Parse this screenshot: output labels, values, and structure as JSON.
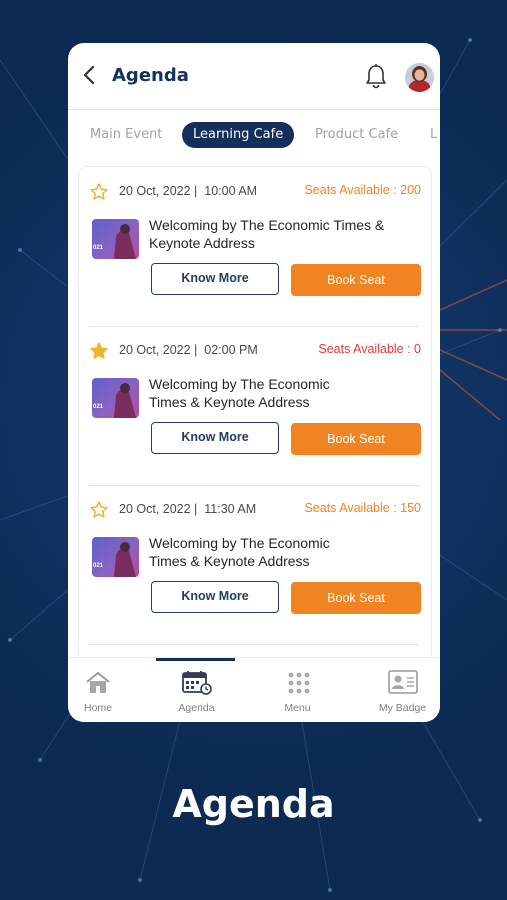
{
  "header": {
    "title": "Agenda",
    "back_icon": "chevron-left-icon",
    "bell_icon": "bell-icon",
    "avatar": "user-avatar"
  },
  "tabs": [
    {
      "label": "Main Event",
      "active": false
    },
    {
      "label": "Learning Cafe",
      "active": true
    },
    {
      "label": "Product Cafe",
      "active": false
    },
    {
      "label": "L",
      "active": false
    }
  ],
  "events": [
    {
      "starred": false,
      "date": "20 Oct, 2022",
      "time": "10:00 AM",
      "seats_text": "Seats Available : 200",
      "seats_color": "#f08423",
      "title": "Welcoming by The Economic Times & Keynote Address",
      "thumb_tag": "021",
      "know_more": "Know More",
      "book_seat": "Book Seat"
    },
    {
      "starred": true,
      "date": "20 Oct, 2022",
      "time": "02:00 PM",
      "seats_text": "Seats Available : 0",
      "seats_color": "#e53935",
      "title": "Welcoming by The Economic Times & Keynote Address",
      "thumb_tag": "021",
      "know_more": "Know More",
      "book_seat": "Book Seat"
    },
    {
      "starred": false,
      "date": "20 Oct, 2022",
      "time": "11:30 AM",
      "seats_text": "Seats Available : 150",
      "seats_color": "#f08423",
      "title": "Welcoming by The Economic Times & Keynote Address",
      "thumb_tag": "021",
      "know_more": "Know More",
      "book_seat": "Book Seat"
    }
  ],
  "bottom_nav": [
    {
      "label": "Home",
      "icon": "home-icon",
      "active": false
    },
    {
      "label": "Agenda",
      "icon": "calendar-icon",
      "active": true
    },
    {
      "label": "Menu",
      "icon": "grid-icon",
      "active": false
    },
    {
      "label": "My Badge",
      "icon": "badge-icon",
      "active": false
    }
  ],
  "caption": "Agenda",
  "colors": {
    "primary": "#132f5a",
    "accent": "#f08423",
    "star": "#f0b429",
    "background": "#0c2a52"
  }
}
